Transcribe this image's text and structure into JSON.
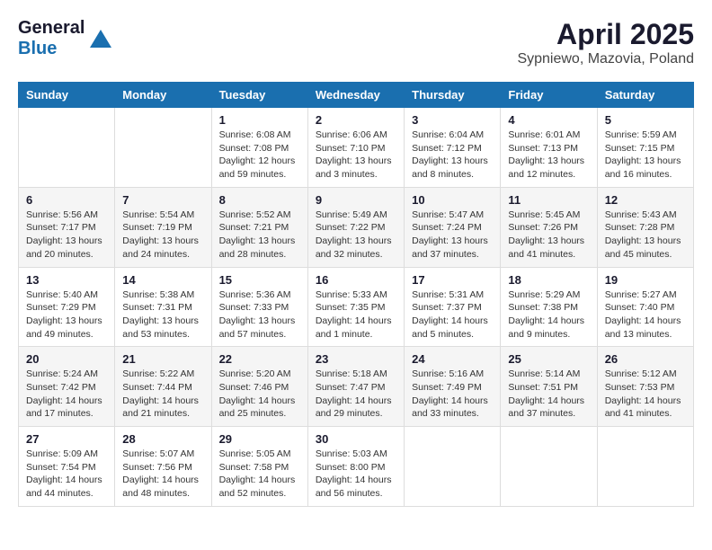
{
  "header": {
    "logo": {
      "line1": "General",
      "line2": "Blue"
    },
    "title": "April 2025",
    "location": "Sypniewo, Mazovia, Poland"
  },
  "calendar": {
    "days_of_week": [
      "Sunday",
      "Monday",
      "Tuesday",
      "Wednesday",
      "Thursday",
      "Friday",
      "Saturday"
    ],
    "weeks": [
      [
        {
          "day": "",
          "info": ""
        },
        {
          "day": "",
          "info": ""
        },
        {
          "day": "1",
          "info": "Sunrise: 6:08 AM\nSunset: 7:08 PM\nDaylight: 12 hours and 59 minutes."
        },
        {
          "day": "2",
          "info": "Sunrise: 6:06 AM\nSunset: 7:10 PM\nDaylight: 13 hours and 3 minutes."
        },
        {
          "day": "3",
          "info": "Sunrise: 6:04 AM\nSunset: 7:12 PM\nDaylight: 13 hours and 8 minutes."
        },
        {
          "day": "4",
          "info": "Sunrise: 6:01 AM\nSunset: 7:13 PM\nDaylight: 13 hours and 12 minutes."
        },
        {
          "day": "5",
          "info": "Sunrise: 5:59 AM\nSunset: 7:15 PM\nDaylight: 13 hours and 16 minutes."
        }
      ],
      [
        {
          "day": "6",
          "info": "Sunrise: 5:56 AM\nSunset: 7:17 PM\nDaylight: 13 hours and 20 minutes."
        },
        {
          "day": "7",
          "info": "Sunrise: 5:54 AM\nSunset: 7:19 PM\nDaylight: 13 hours and 24 minutes."
        },
        {
          "day": "8",
          "info": "Sunrise: 5:52 AM\nSunset: 7:21 PM\nDaylight: 13 hours and 28 minutes."
        },
        {
          "day": "9",
          "info": "Sunrise: 5:49 AM\nSunset: 7:22 PM\nDaylight: 13 hours and 32 minutes."
        },
        {
          "day": "10",
          "info": "Sunrise: 5:47 AM\nSunset: 7:24 PM\nDaylight: 13 hours and 37 minutes."
        },
        {
          "day": "11",
          "info": "Sunrise: 5:45 AM\nSunset: 7:26 PM\nDaylight: 13 hours and 41 minutes."
        },
        {
          "day": "12",
          "info": "Sunrise: 5:43 AM\nSunset: 7:28 PM\nDaylight: 13 hours and 45 minutes."
        }
      ],
      [
        {
          "day": "13",
          "info": "Sunrise: 5:40 AM\nSunset: 7:29 PM\nDaylight: 13 hours and 49 minutes."
        },
        {
          "day": "14",
          "info": "Sunrise: 5:38 AM\nSunset: 7:31 PM\nDaylight: 13 hours and 53 minutes."
        },
        {
          "day": "15",
          "info": "Sunrise: 5:36 AM\nSunset: 7:33 PM\nDaylight: 13 hours and 57 minutes."
        },
        {
          "day": "16",
          "info": "Sunrise: 5:33 AM\nSunset: 7:35 PM\nDaylight: 14 hours and 1 minute."
        },
        {
          "day": "17",
          "info": "Sunrise: 5:31 AM\nSunset: 7:37 PM\nDaylight: 14 hours and 5 minutes."
        },
        {
          "day": "18",
          "info": "Sunrise: 5:29 AM\nSunset: 7:38 PM\nDaylight: 14 hours and 9 minutes."
        },
        {
          "day": "19",
          "info": "Sunrise: 5:27 AM\nSunset: 7:40 PM\nDaylight: 14 hours and 13 minutes."
        }
      ],
      [
        {
          "day": "20",
          "info": "Sunrise: 5:24 AM\nSunset: 7:42 PM\nDaylight: 14 hours and 17 minutes."
        },
        {
          "day": "21",
          "info": "Sunrise: 5:22 AM\nSunset: 7:44 PM\nDaylight: 14 hours and 21 minutes."
        },
        {
          "day": "22",
          "info": "Sunrise: 5:20 AM\nSunset: 7:46 PM\nDaylight: 14 hours and 25 minutes."
        },
        {
          "day": "23",
          "info": "Sunrise: 5:18 AM\nSunset: 7:47 PM\nDaylight: 14 hours and 29 minutes."
        },
        {
          "day": "24",
          "info": "Sunrise: 5:16 AM\nSunset: 7:49 PM\nDaylight: 14 hours and 33 minutes."
        },
        {
          "day": "25",
          "info": "Sunrise: 5:14 AM\nSunset: 7:51 PM\nDaylight: 14 hours and 37 minutes."
        },
        {
          "day": "26",
          "info": "Sunrise: 5:12 AM\nSunset: 7:53 PM\nDaylight: 14 hours and 41 minutes."
        }
      ],
      [
        {
          "day": "27",
          "info": "Sunrise: 5:09 AM\nSunset: 7:54 PM\nDaylight: 14 hours and 44 minutes."
        },
        {
          "day": "28",
          "info": "Sunrise: 5:07 AM\nSunset: 7:56 PM\nDaylight: 14 hours and 48 minutes."
        },
        {
          "day": "29",
          "info": "Sunrise: 5:05 AM\nSunset: 7:58 PM\nDaylight: 14 hours and 52 minutes."
        },
        {
          "day": "30",
          "info": "Sunrise: 5:03 AM\nSunset: 8:00 PM\nDaylight: 14 hours and 56 minutes."
        },
        {
          "day": "",
          "info": ""
        },
        {
          "day": "",
          "info": ""
        },
        {
          "day": "",
          "info": ""
        }
      ]
    ]
  }
}
